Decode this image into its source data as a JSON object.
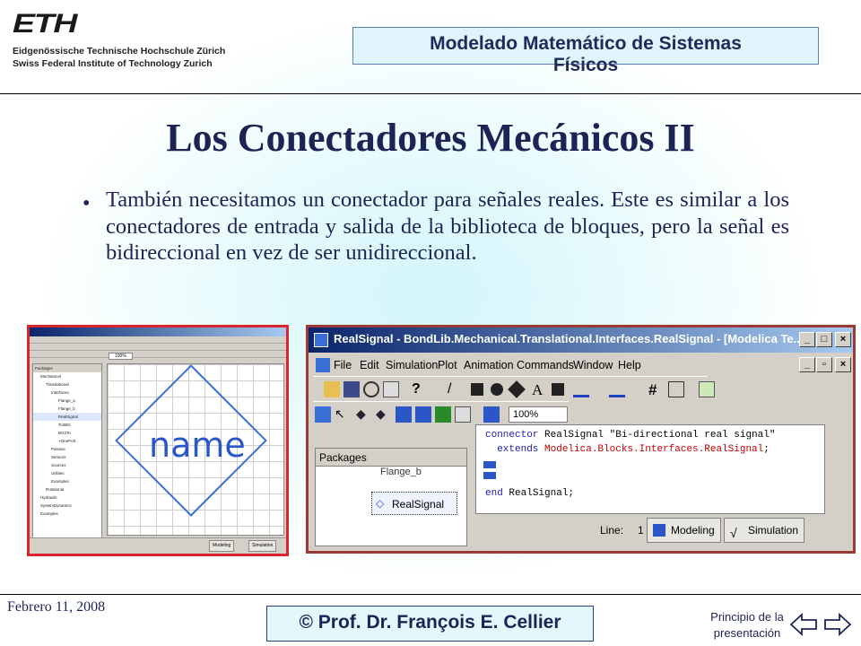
{
  "header": {
    "logo_word": "ETH",
    "logo_line1": "Eidgenössische Technische Hochschule Zürich",
    "logo_line2": "Swiss Federal Institute of Technology Zurich",
    "course_line1": "Modelado Matemático de Sistemas",
    "course_line2": "Físicos"
  },
  "slide": {
    "title": "Los Conectadores Mecánicos II",
    "bullet": "•",
    "body": "También necesitamos un conectador para señales reales. Este es similar a los conectadores de entrada y salida de la biblioteca de bloques, pero la señal es bidireccional en vez de ser unidireccional."
  },
  "screenshot_left": {
    "canvas_label": "name",
    "tree": [
      "Packages",
      "Mechanical",
      "Translational",
      "Interfaces",
      "Flange_a",
      "Flange_b",
      "RealSignal",
      "To2BG",
      "BG2To",
      "+OnePort",
      "Passive",
      "Sensors",
      "Sources",
      "Utilities",
      "Examples",
      "Rotational",
      "Hydraulic",
      "SystemDynamics",
      "Examples"
    ],
    "tabs": [
      "Modeling",
      "Simulation"
    ],
    "zoom": "100%"
  },
  "screenshot_right": {
    "window_title": "RealSignal - BondLib.Mechanical.Translational.Interfaces.RealSignal - [Modelica Te...",
    "menu": [
      "File",
      "Edit",
      "Simulation",
      "Plot",
      "Animation",
      "Commands",
      "Window",
      "Help"
    ],
    "zoom": "100%",
    "packages_header": "Packages",
    "packages_items": [
      "Flange_b",
      "RealSignal"
    ],
    "code": {
      "line1_kw": "connector",
      "line1_rest": " RealSignal \"Bi-directional real signal\"",
      "line2_kw": "  extends",
      "line2_rest": " Modelica.Blocks.Interfaces.RealSignal",
      "line2_end": ";",
      "line3_kw": "end",
      "line3_rest": " RealSignal;"
    },
    "status_line_label": "Line:",
    "status_line_value": "1",
    "tabs": [
      "Modeling",
      "Simulation"
    ]
  },
  "footer": {
    "date": "Febrero 11, 2008",
    "author": "©  Prof. Dr. François E. Cellier",
    "link_line1": "Principio de la",
    "link_line2": "presentación"
  },
  "colors": {
    "title": "#1c2456",
    "left_frame": "#d8262e",
    "right_frame": "#9e3a36",
    "titlebar": "#0a246a"
  }
}
